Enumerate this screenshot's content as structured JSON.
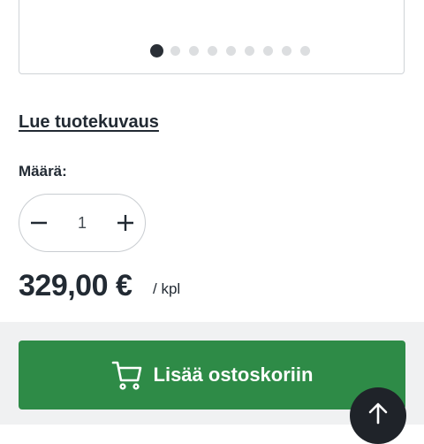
{
  "gallery": {
    "slide_count": 9,
    "active_index": 0
  },
  "product": {
    "read_description_link": "Lue tuotekuvaus",
    "quantity_label": "Määrä:",
    "quantity_value": "1",
    "price": "329,00 €",
    "unit": "/ kpl"
  },
  "actions": {
    "add_to_cart_label": "Lisää ostoskoriin",
    "cart_icon": "cart-icon",
    "scroll_top_icon": "arrow-up-icon"
  },
  "colors": {
    "primary_green": "#2e8b47",
    "text_dark": "#222a33",
    "scroll_top_bg": "#1f2329"
  }
}
